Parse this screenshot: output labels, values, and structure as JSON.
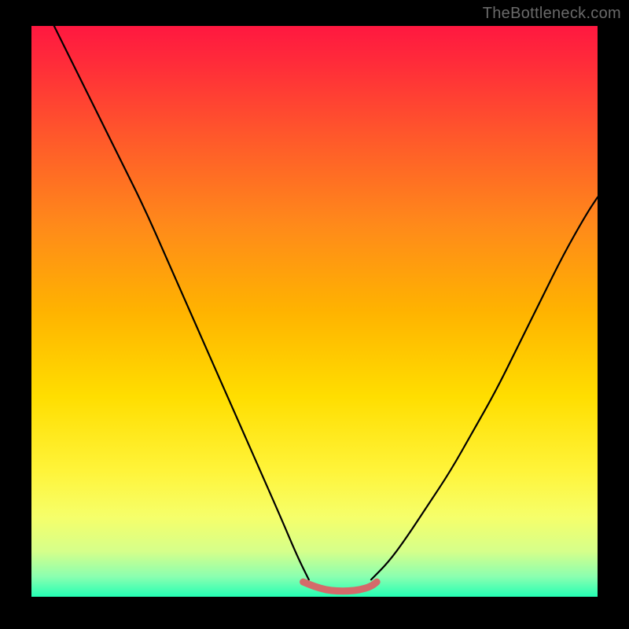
{
  "watermark": "TheBottleneck.com",
  "chart_data": {
    "type": "line",
    "title": "",
    "xlabel": "",
    "ylabel": "",
    "xlim": [
      0,
      100
    ],
    "ylim": [
      0,
      100
    ],
    "gradient_stops": [
      {
        "offset": 0.0,
        "color": "#ff1840"
      },
      {
        "offset": 0.06,
        "color": "#ff2a3a"
      },
      {
        "offset": 0.2,
        "color": "#ff5a2a"
      },
      {
        "offset": 0.35,
        "color": "#ff8a1a"
      },
      {
        "offset": 0.5,
        "color": "#ffb300"
      },
      {
        "offset": 0.65,
        "color": "#ffde00"
      },
      {
        "offset": 0.78,
        "color": "#fff43a"
      },
      {
        "offset": 0.86,
        "color": "#f6ff6a"
      },
      {
        "offset": 0.92,
        "color": "#d6ff8a"
      },
      {
        "offset": 0.965,
        "color": "#8affb0"
      },
      {
        "offset": 1.0,
        "color": "#24ffb4"
      }
    ],
    "series": [
      {
        "name": "left-curve",
        "stroke": "#000000",
        "x": [
          4,
          8,
          12,
          16,
          20,
          24,
          28,
          32,
          36,
          40,
          44,
          47,
          49
        ],
        "y": [
          100,
          92,
          84,
          76,
          68,
          59,
          50,
          41,
          32,
          23,
          14,
          7,
          3
        ]
      },
      {
        "name": "right-curve",
        "stroke": "#000000",
        "x": [
          60,
          63,
          66,
          70,
          74,
          78,
          82,
          86,
          90,
          94,
          98,
          100
        ],
        "y": [
          3,
          6,
          10,
          16,
          22,
          29,
          36,
          44,
          52,
          60,
          67,
          70
        ]
      },
      {
        "name": "flat-highlight",
        "stroke": "#d46a6a",
        "x": [
          48,
          50,
          52,
          54,
          56,
          58,
          60,
          61
        ],
        "y": [
          2.6,
          1.8,
          1.2,
          1.0,
          1.0,
          1.2,
          1.8,
          2.6
        ]
      }
    ],
    "annotations": []
  }
}
